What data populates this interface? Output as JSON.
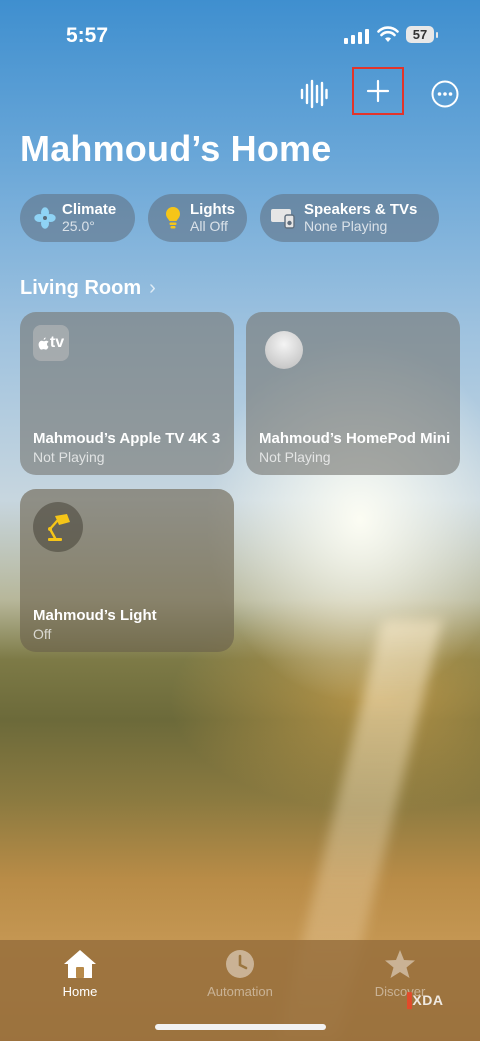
{
  "status_bar": {
    "time": "5:57",
    "battery": "57"
  },
  "toolbar": {
    "voice_icon": "waveform-icon",
    "add_icon": "plus-icon",
    "more_icon": "ellipsis-circle-icon"
  },
  "title": "Mahmoud’s Home",
  "chips": [
    {
      "label": "Climate",
      "value": "25.0°",
      "icon": "fan-icon"
    },
    {
      "label": "Lights",
      "value": "All Off",
      "icon": "lightbulb-icon"
    },
    {
      "label": "Speakers & TVs",
      "value": "None Playing",
      "icon": "speakers-tv-icon"
    }
  ],
  "section": {
    "title": "Living Room"
  },
  "accessories": [
    {
      "name": "Mahmoud’s Apple TV 4K 3",
      "status": "Not Playing",
      "icon": "apple-tv-icon",
      "badge": "tv"
    },
    {
      "name": "Mahmoud’s HomePod Mini",
      "status": "Not Playing",
      "icon": "homepod-mini-icon"
    },
    {
      "name": "Mahmoud’s Light",
      "status": "Off",
      "icon": "desk-lamp-icon"
    }
  ],
  "tabs": [
    {
      "label": "Home",
      "icon": "house-icon",
      "active": true
    },
    {
      "label": "Automation",
      "icon": "clock-icon",
      "active": false
    },
    {
      "label": "Discover",
      "icon": "star-icon",
      "active": false
    }
  ],
  "watermark": "XDA",
  "colors": {
    "highlight_border": "#e2342b",
    "lamp_yellow": "#f5c518"
  }
}
